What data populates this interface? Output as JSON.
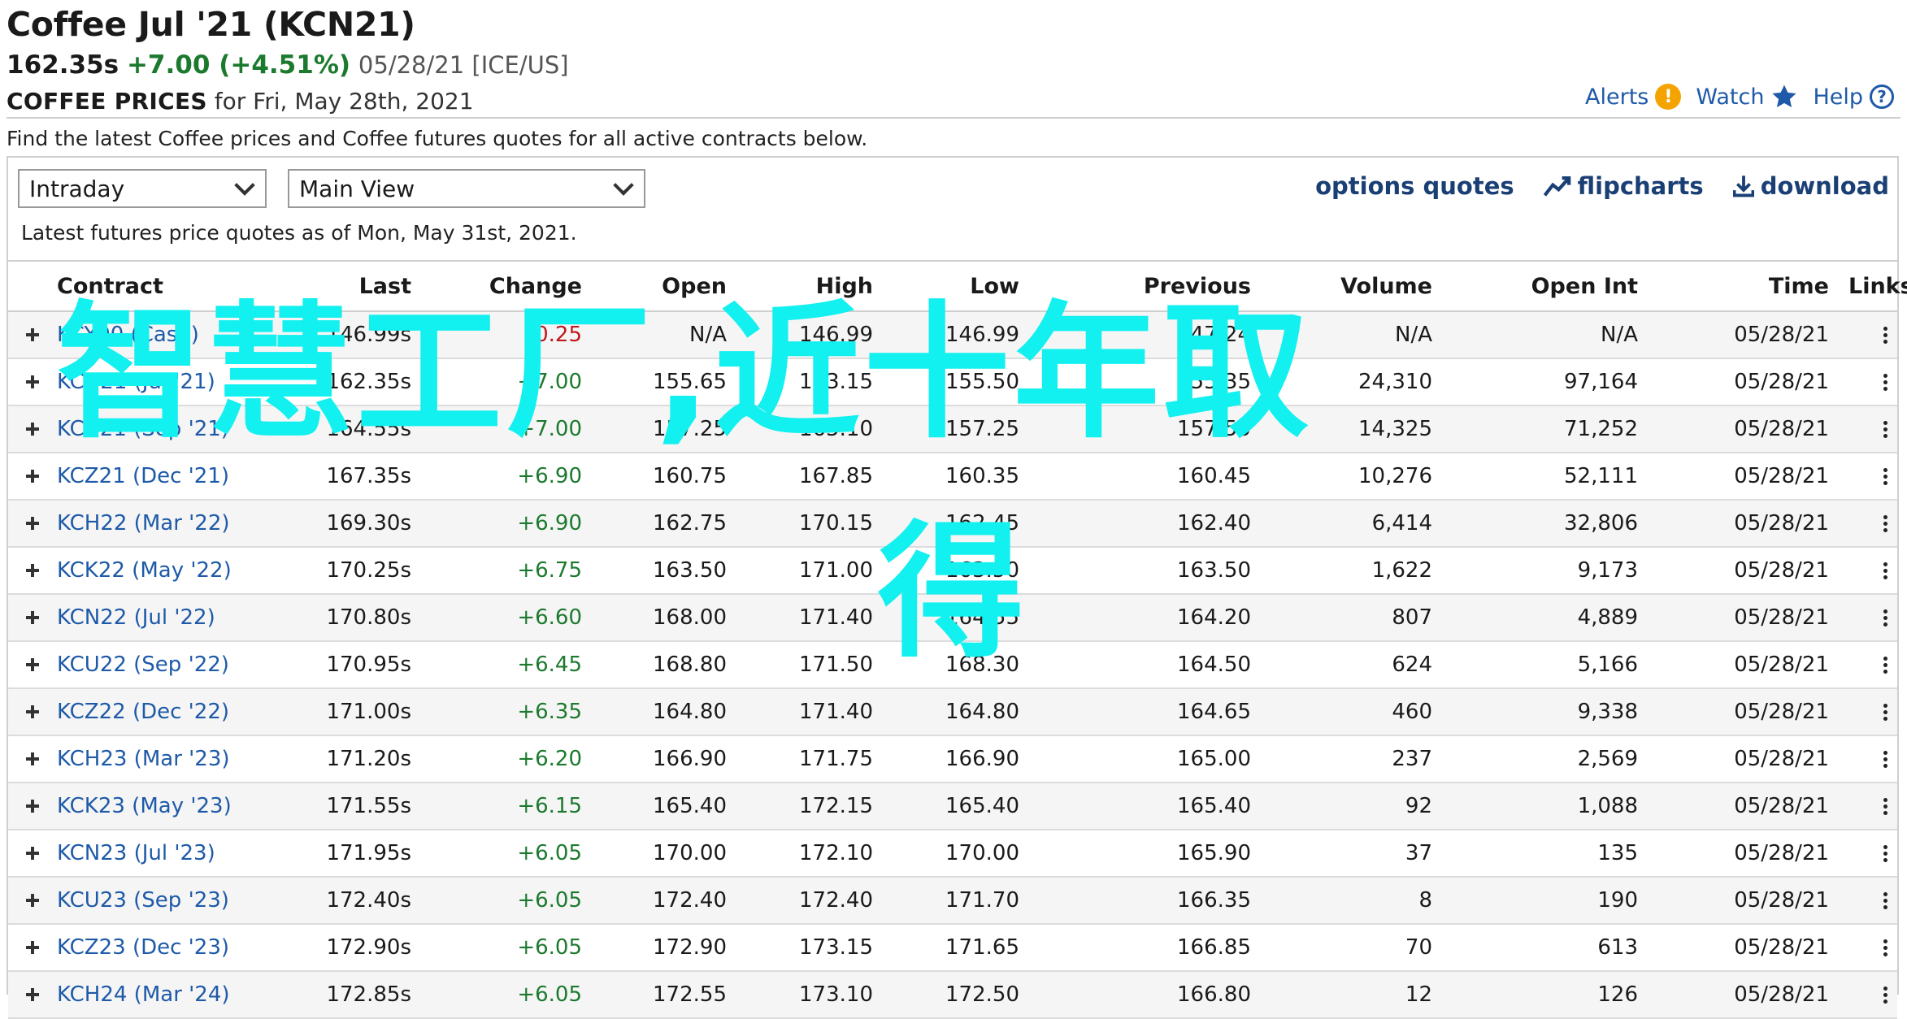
{
  "header": {
    "title": "Coffee Jul '21 (KCN21)",
    "last": "162.35s",
    "change": "+7.00 (+4.51%)",
    "date_exchange": "05/28/21 [ICE/US]",
    "subtitle_bold": "COFFEE PRICES",
    "subtitle_rest": "for Fri, May 28th, 2021"
  },
  "top_links": {
    "alerts": "Alerts",
    "alerts_badge": "!",
    "watch": "Watch",
    "help": "Help",
    "help_badge": "?"
  },
  "description": "Find the latest Coffee prices and Coffee futures quotes for all active contracts below.",
  "controls": {
    "period_select": "Intraday",
    "view_select": "Main View",
    "options_quotes": "options quotes",
    "flipcharts": "flipcharts",
    "download": "download"
  },
  "as_of": "Latest futures price quotes as of Mon, May 31st, 2021.",
  "table": {
    "columns": [
      "Contract",
      "Last",
      "Change",
      "Open",
      "High",
      "Low",
      "Previous",
      "Volume",
      "Open Int",
      "Time",
      "Links"
    ],
    "rows": [
      [
        "KCY00 (Cash)",
        "146.99s",
        "-0.25",
        "N/A",
        "146.99",
        "146.99",
        "147.24",
        "N/A",
        "N/A",
        "05/28/21"
      ],
      [
        "KCN21 (Jul '21)",
        "162.35s",
        "+7.00",
        "155.65",
        "163.15",
        "155.50",
        "155.35",
        "24,310",
        "97,164",
        "05/28/21"
      ],
      [
        "KCU21 (Sep '21)",
        "164.55s",
        "+7.00",
        "157.25",
        "165.10",
        "157.25",
        "157.55",
        "14,325",
        "71,252",
        "05/28/21"
      ],
      [
        "KCZ21 (Dec '21)",
        "167.35s",
        "+6.90",
        "160.75",
        "167.85",
        "160.35",
        "160.45",
        "10,276",
        "52,111",
        "05/28/21"
      ],
      [
        "KCH22 (Mar '22)",
        "169.30s",
        "+6.90",
        "162.75",
        "170.15",
        "162.45",
        "162.40",
        "6,414",
        "32,806",
        "05/28/21"
      ],
      [
        "KCK22 (May '22)",
        "170.25s",
        "+6.75",
        "163.50",
        "171.00",
        "163.50",
        "163.50",
        "1,622",
        "9,173",
        "05/28/21"
      ],
      [
        "KCN22 (Jul '22)",
        "170.80s",
        "+6.60",
        "168.00",
        "171.40",
        "164.55",
        "164.20",
        "807",
        "4,889",
        "05/28/21"
      ],
      [
        "KCU22 (Sep '22)",
        "170.95s",
        "+6.45",
        "168.80",
        "171.50",
        "168.30",
        "164.50",
        "624",
        "5,166",
        "05/28/21"
      ],
      [
        "KCZ22 (Dec '22)",
        "171.00s",
        "+6.35",
        "164.80",
        "171.40",
        "164.80",
        "164.65",
        "460",
        "9,338",
        "05/28/21"
      ],
      [
        "KCH23 (Mar '23)",
        "171.20s",
        "+6.20",
        "166.90",
        "171.75",
        "166.90",
        "165.00",
        "237",
        "2,569",
        "05/28/21"
      ],
      [
        "KCK23 (May '23)",
        "171.55s",
        "+6.15",
        "165.40",
        "172.15",
        "165.40",
        "165.40",
        "92",
        "1,088",
        "05/28/21"
      ],
      [
        "KCN23 (Jul '23)",
        "171.95s",
        "+6.05",
        "170.00",
        "172.10",
        "170.00",
        "165.90",
        "37",
        "135",
        "05/28/21"
      ],
      [
        "KCU23 (Sep '23)",
        "172.40s",
        "+6.05",
        "172.40",
        "172.40",
        "171.70",
        "166.35",
        "8",
        "190",
        "05/28/21"
      ],
      [
        "KCZ23 (Dec '23)",
        "172.90s",
        "+6.05",
        "172.90",
        "173.15",
        "171.65",
        "166.85",
        "70",
        "613",
        "05/28/21"
      ],
      [
        "KCH24 (Mar '24)",
        "172.85s",
        "+6.05",
        "172.55",
        "173.10",
        "172.50",
        "166.80",
        "12",
        "126",
        "05/28/21"
      ]
    ]
  },
  "overlay": {
    "line1": "智慧工厂,近十年取",
    "line2": "得"
  },
  "colors": {
    "link_blue": "#1e5aa8",
    "positive": "#1c7a2e",
    "negative": "#c0171c",
    "overlay_cyan": "#12f0f0"
  }
}
